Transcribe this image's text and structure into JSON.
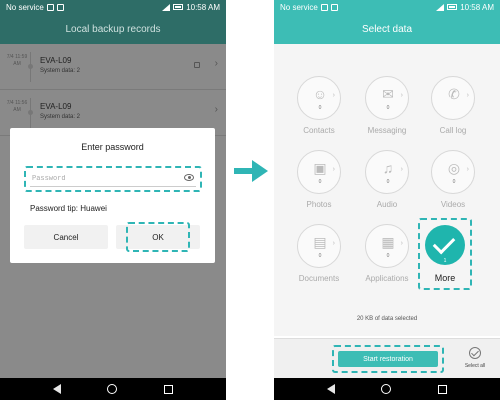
{
  "left_phone": {
    "status": {
      "carrier": "No service",
      "time": "10:58 AM"
    },
    "title": "Local backup records",
    "records": [
      {
        "date": "7/4 11:59 AM",
        "name": "EVA-L09",
        "sub": "System data: 2"
      },
      {
        "date": "7/4 11:56 AM",
        "name": "EVA-L09",
        "sub": "System data: 2"
      }
    ],
    "dialog": {
      "title": "Enter password",
      "password_placeholder": "Password",
      "tip": "Password tip: Huawei",
      "cancel_label": "Cancel",
      "ok_label": "OK"
    }
  },
  "right_phone": {
    "status": {
      "carrier": "No service",
      "time": "10:58 AM"
    },
    "title": "Select data",
    "tiles": [
      {
        "label": "Contacts",
        "count": "0",
        "icon": "contacts-icon",
        "glyph": "☺"
      },
      {
        "label": "Messaging",
        "count": "0",
        "icon": "messaging-icon",
        "glyph": "✉"
      },
      {
        "label": "Call log",
        "count": "",
        "icon": "call-log-icon",
        "glyph": "✆"
      },
      {
        "label": "Photos",
        "count": "0",
        "icon": "photos-icon",
        "glyph": "▣"
      },
      {
        "label": "Audio",
        "count": "0",
        "icon": "audio-icon",
        "glyph": "♫"
      },
      {
        "label": "Videos",
        "count": "0",
        "icon": "videos-icon",
        "glyph": "◎"
      },
      {
        "label": "Documents",
        "count": "0",
        "icon": "documents-icon",
        "glyph": "▤"
      },
      {
        "label": "Applications",
        "count": "0",
        "icon": "applications-icon",
        "glyph": "▦"
      }
    ],
    "more": {
      "label": "More",
      "count": "1"
    },
    "selected_info": "20 KB of data selected",
    "restore_label": "Start restoration",
    "select_all_label": "Select all"
  },
  "colors": {
    "teal": "#3dbdb5",
    "dark_teal": "#2e6d67",
    "highlight": "#2fb5b5"
  }
}
